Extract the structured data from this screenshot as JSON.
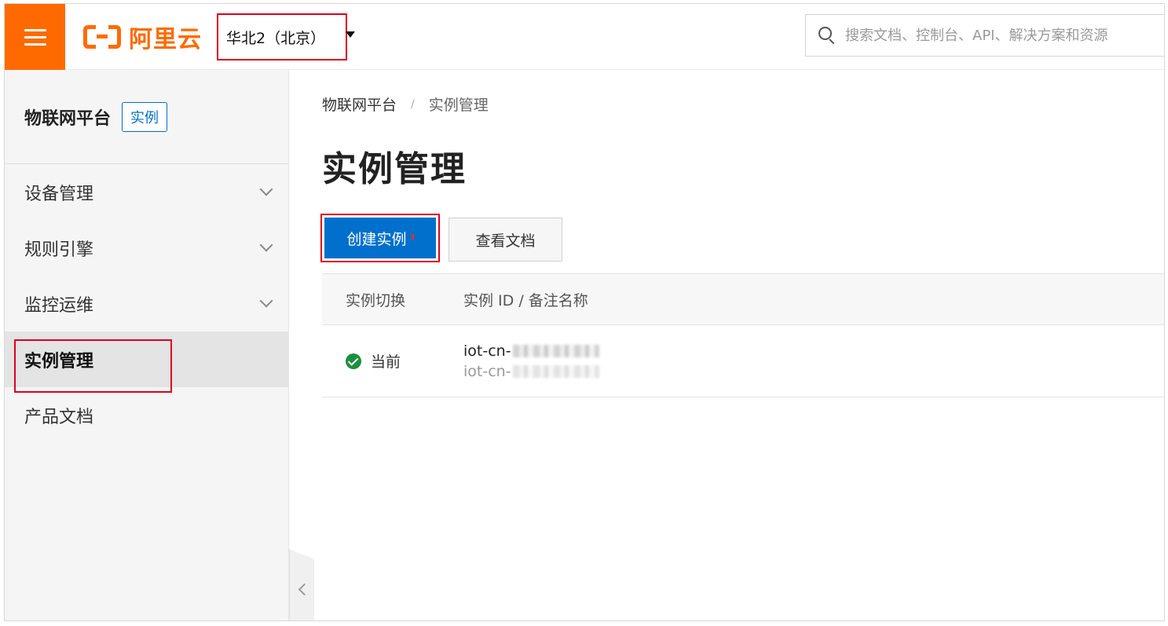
{
  "topbar": {
    "logo_text": "阿里云",
    "region": "华北2（北京）",
    "search_placeholder": "搜索文档、控制台、API、解决方案和资源"
  },
  "sidebar": {
    "title": "物联网平台",
    "tag": "实例",
    "items": [
      {
        "label": "设备管理"
      },
      {
        "label": "规则引擎"
      },
      {
        "label": "监控运维"
      },
      {
        "label": "实例管理"
      },
      {
        "label": "产品文档"
      }
    ]
  },
  "main": {
    "breadcrumb": [
      "物联网平台",
      "实例管理"
    ],
    "breadcrumb_sep": "/",
    "title": "实例管理",
    "create_button": "创建实例",
    "doc_button": "查看文档",
    "table": {
      "headers": [
        "实例切换",
        "实例 ID / 备注名称"
      ],
      "rows": [
        {
          "status": "当前",
          "id": "iot-cn-",
          "note": "iot-cn-"
        }
      ]
    }
  },
  "colors": {
    "brand": "#ff6a00",
    "primary": "#0070cc",
    "highlight": "#e0001b",
    "success": "#1e8e3e"
  }
}
